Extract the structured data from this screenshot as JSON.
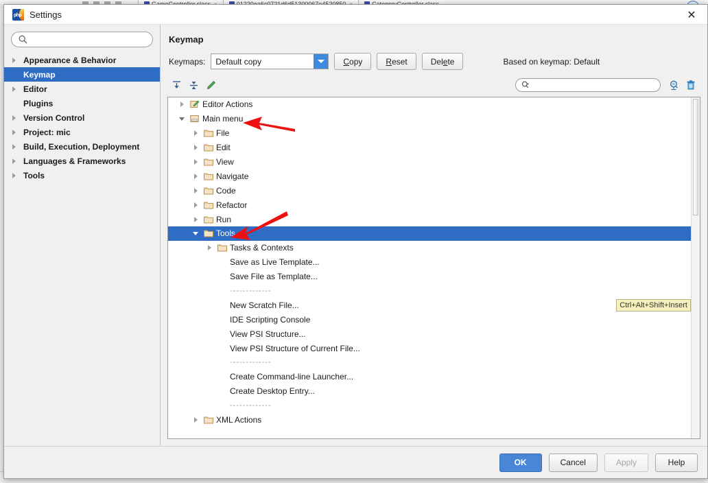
{
  "background": {
    "tabs": [
      {
        "label": "GameController.class"
      },
      {
        "label": "01220ea6c0721d6d51300067e4520850"
      },
      {
        "label": "CategoryController.class"
      }
    ],
    "close_glyph": "×",
    "left_edge_glyph": "≡"
  },
  "dialog": {
    "title": "Settings",
    "app_icon": "phpstorm-icon",
    "close_glyph": "✕"
  },
  "sidebar": {
    "search": {
      "value": "",
      "placeholder": ""
    },
    "items": [
      {
        "label": "Appearance & Behavior",
        "arrow": true,
        "selected": false
      },
      {
        "label": "Keymap",
        "arrow": false,
        "selected": true
      },
      {
        "label": "Editor",
        "arrow": true,
        "selected": false
      },
      {
        "label": "Plugins",
        "arrow": false,
        "selected": false
      },
      {
        "label": "Version Control",
        "arrow": true,
        "selected": false
      },
      {
        "label": "Project: mic",
        "arrow": true,
        "selected": false
      },
      {
        "label": "Build, Execution, Deployment",
        "arrow": true,
        "selected": false
      },
      {
        "label": "Languages & Frameworks",
        "arrow": true,
        "selected": false
      },
      {
        "label": "Tools",
        "arrow": true,
        "selected": false
      }
    ]
  },
  "main": {
    "title": "Keymap",
    "keymaps_label": "Keymaps:",
    "keymap_selected": "Default copy",
    "buttons": {
      "copy": "Copy",
      "reset": "Reset",
      "delete": "Delete"
    },
    "based_on": "Based on keymap: Default",
    "toolbar": {
      "expand_all": "expand-all-icon",
      "collapse_all": "collapse-all-icon",
      "edit_shortcut": "pencil-edit-icon",
      "find_placeholder": "",
      "find_value": "",
      "find_by_shortcut": "find-by-shortcut-icon",
      "clear_shortcut": "delete-shortcut-icon"
    },
    "tree": [
      {
        "label": "Editor Actions",
        "depth": 0,
        "state": "collapsed",
        "icon": "editor-actions-icon",
        "selected": false
      },
      {
        "label": "Main menu",
        "depth": 0,
        "state": "expanded",
        "icon": "main-menu-icon",
        "selected": false
      },
      {
        "label": "File",
        "depth": 1,
        "state": "collapsed",
        "icon": "folder-icon",
        "selected": false
      },
      {
        "label": "Edit",
        "depth": 1,
        "state": "collapsed",
        "icon": "folder-icon",
        "selected": false
      },
      {
        "label": "View",
        "depth": 1,
        "state": "collapsed",
        "icon": "folder-icon",
        "selected": false
      },
      {
        "label": "Navigate",
        "depth": 1,
        "state": "collapsed",
        "icon": "folder-icon",
        "selected": false
      },
      {
        "label": "Code",
        "depth": 1,
        "state": "collapsed",
        "icon": "folder-icon",
        "selected": false
      },
      {
        "label": "Refactor",
        "depth": 1,
        "state": "collapsed",
        "icon": "folder-icon",
        "selected": false
      },
      {
        "label": "Run",
        "depth": 1,
        "state": "collapsed",
        "icon": "folder-icon",
        "selected": false
      },
      {
        "label": "Tools",
        "depth": 1,
        "state": "expanded",
        "icon": "folder-icon",
        "selected": true
      },
      {
        "label": "Tasks & Contexts",
        "depth": 2,
        "state": "collapsed",
        "icon": "folder-icon",
        "selected": false
      },
      {
        "label": "Save as Live Template...",
        "depth": 2,
        "state": "leaf",
        "icon": "none",
        "selected": false
      },
      {
        "label": "Save File as Template...",
        "depth": 2,
        "state": "leaf",
        "icon": "none",
        "selected": false
      },
      {
        "label": "-------------",
        "depth": 2,
        "state": "separator",
        "icon": "none",
        "selected": false
      },
      {
        "label": "New Scratch File...",
        "depth": 2,
        "state": "leaf",
        "icon": "none",
        "selected": false,
        "shortcut": "Ctrl+Alt+Shift+Insert"
      },
      {
        "label": "IDE Scripting Console",
        "depth": 2,
        "state": "leaf",
        "icon": "none",
        "selected": false
      },
      {
        "label": "View PSI Structure...",
        "depth": 2,
        "state": "leaf",
        "icon": "none",
        "selected": false
      },
      {
        "label": "View PSI Structure of Current File...",
        "depth": 2,
        "state": "leaf",
        "icon": "none",
        "selected": false
      },
      {
        "label": "-------------",
        "depth": 2,
        "state": "separator",
        "icon": "none",
        "selected": false
      },
      {
        "label": "Create Command-line Launcher...",
        "depth": 2,
        "state": "leaf",
        "icon": "none",
        "selected": false
      },
      {
        "label": "Create Desktop Entry...",
        "depth": 2,
        "state": "leaf",
        "icon": "none",
        "selected": false
      },
      {
        "label": "-------------",
        "depth": 2,
        "state": "separator",
        "icon": "none",
        "selected": false
      },
      {
        "label": "XML Actions",
        "depth": 1,
        "state": "collapsed",
        "icon": "folder-icon",
        "selected": false
      }
    ]
  },
  "footer": {
    "ok": "OK",
    "cancel": "Cancel",
    "apply": "Apply",
    "help": "Help"
  },
  "annotations": [
    {
      "name": "arrow-to-main-menu",
      "color": "#ee1111"
    },
    {
      "name": "arrow-to-tools",
      "color": "#ee1111"
    }
  ],
  "colors": {
    "selection_blue": "#2f6cc4",
    "primary_button": "#4a86d8",
    "shortcut_badge_bg": "#f5f0bd",
    "annotation_red": "#ee1111",
    "folder_icon": "#c8a06a"
  }
}
